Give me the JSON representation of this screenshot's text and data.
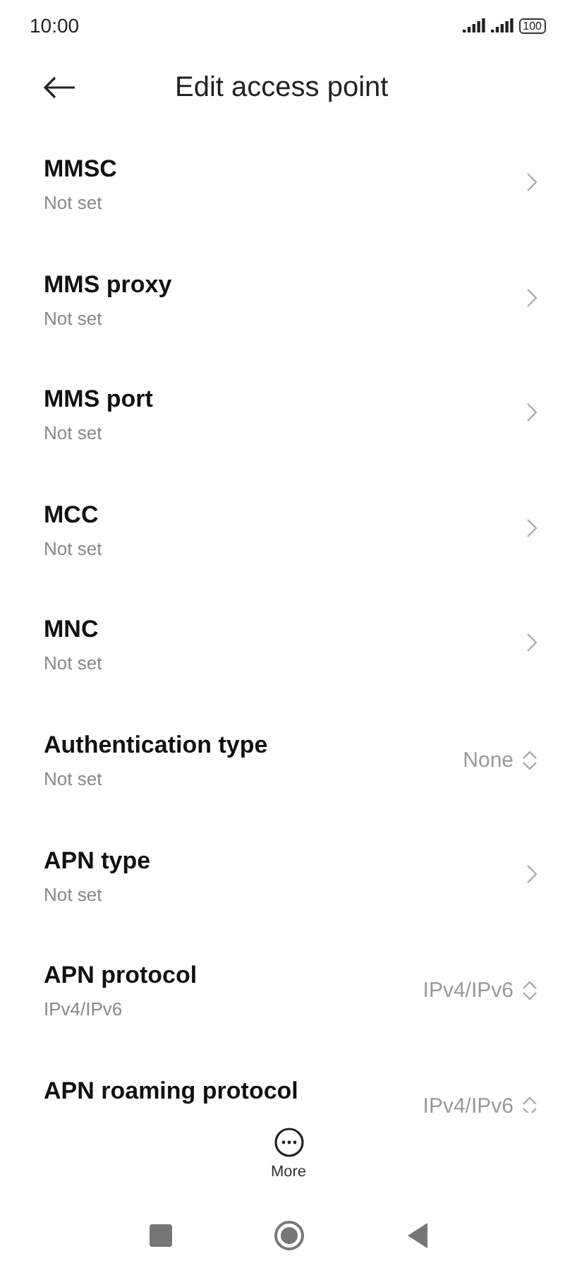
{
  "status_bar": {
    "time": "10:00",
    "battery": "100"
  },
  "header": {
    "title": "Edit access point"
  },
  "items": [
    {
      "kind": "nav",
      "title": "MMSC",
      "subtitle": "Not set"
    },
    {
      "kind": "nav",
      "title": "MMS proxy",
      "subtitle": "Not set"
    },
    {
      "kind": "nav",
      "title": "MMS port",
      "subtitle": "Not set"
    },
    {
      "kind": "nav",
      "title": "MCC",
      "subtitle": "Not set"
    },
    {
      "kind": "nav",
      "title": "MNC",
      "subtitle": "Not set"
    },
    {
      "kind": "select",
      "title": "Authentication type",
      "subtitle": "Not set",
      "value": "None"
    },
    {
      "kind": "nav",
      "title": "APN type",
      "subtitle": "Not set"
    },
    {
      "kind": "select",
      "title": "APN protocol",
      "subtitle": "IPv4/IPv6",
      "value": "IPv4/IPv6"
    },
    {
      "kind": "select",
      "title": "APN roaming protocol",
      "value": "IPv4/IPv6"
    }
  ],
  "more": {
    "label": "More"
  }
}
